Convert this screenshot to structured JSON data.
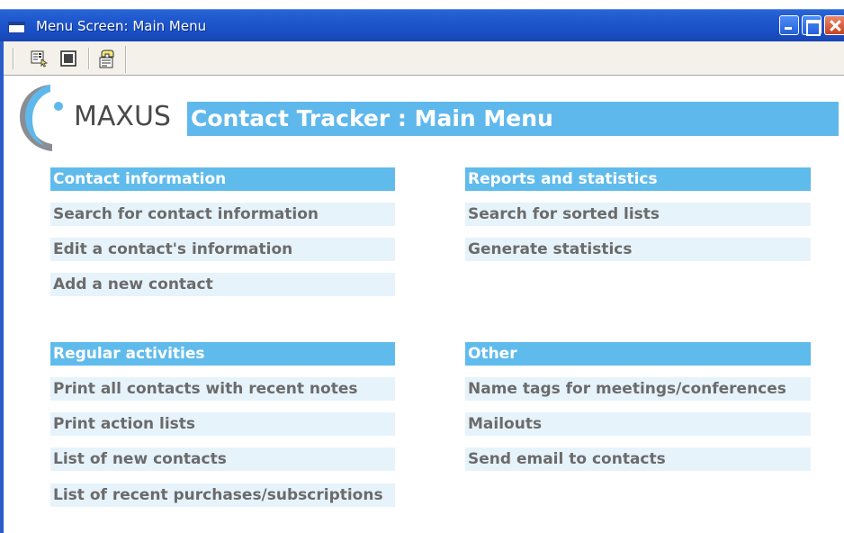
{
  "window": {
    "title": "Menu Screen: Main Menu"
  },
  "toolbar": {
    "buttons": [
      "form-view-icon",
      "design-view-icon",
      "properties-icon"
    ]
  },
  "header": {
    "brand": "MAXUS",
    "title": "Contact Tracker : Main Menu"
  },
  "sections": {
    "contact_information": {
      "heading": "Contact information",
      "items": [
        "Search for contact information",
        "Edit a contact's information",
        "Add a new contact"
      ]
    },
    "reports_and_statistics": {
      "heading": "Reports and statistics",
      "items": [
        "Search for sorted lists",
        "Generate statistics"
      ]
    },
    "regular_activities": {
      "heading": "Regular activities",
      "items": [
        "Print all contacts with recent notes",
        "Print action lists",
        "List of new contacts",
        "List of recent purchases/subscriptions"
      ]
    },
    "other": {
      "heading": "Other",
      "items": [
        "Name tags for meetings/conferences",
        "Mailouts",
        "Send email to contacts"
      ]
    }
  },
  "colors": {
    "titlebar": "#1f58cf",
    "heading_bg": "#60bbed",
    "item_bg": "#e7f3fb",
    "item_text": "#6b6b6b"
  }
}
